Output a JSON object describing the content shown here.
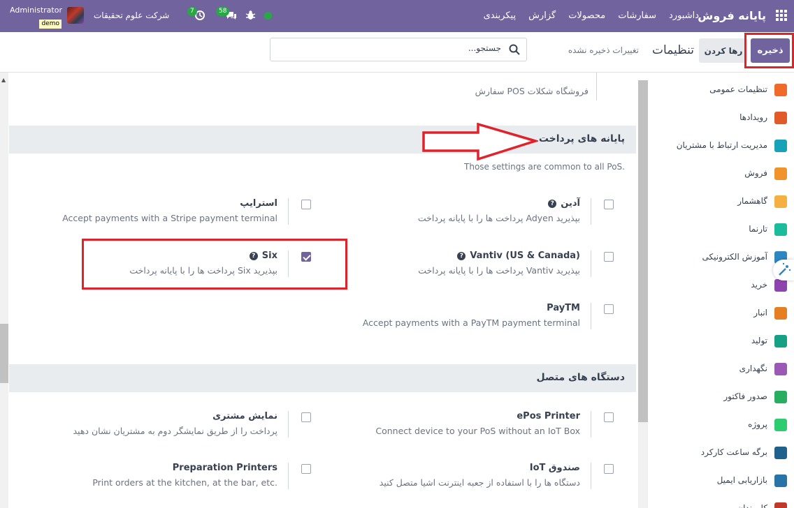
{
  "topnav": {
    "brand": "پایانه فروش",
    "menu": [
      "داشبورد",
      "سفارشات",
      "محصولات",
      "گزارش",
      "پیکربندی"
    ],
    "company": "شرکت علوم تحقیقات",
    "user": "Administrator",
    "db": "demo",
    "messages_count": "58",
    "activities_count": "7",
    "bug_icon": "bug-icon",
    "status_color": "#28a745"
  },
  "control_panel": {
    "save_label": "ذخیره",
    "discard_label": "رها کردن",
    "title": "تنظیمات",
    "unsaved": "تغییرات ذخیره نشده",
    "search_placeholder": "جستجو..."
  },
  "sidebar": {
    "items": [
      {
        "label": "تنظیمات عمومی",
        "color": "#f06a2a"
      },
      {
        "label": "رویدادها",
        "color": "#e05a2a"
      },
      {
        "label": "مدیریت ارتباط با مشتریان",
        "color": "#17a2b8"
      },
      {
        "label": "فروش",
        "color": "#f0932b"
      },
      {
        "label": "گاهشمار",
        "color": "#f5b041"
      },
      {
        "label": "تارنما",
        "color": "#1abc9c"
      },
      {
        "label": "آموزش الکترونیکی",
        "color": "#2e86c1"
      },
      {
        "label": "خرید",
        "color": "#8e44ad"
      },
      {
        "label": "انبار",
        "color": "#e67e22"
      },
      {
        "label": "تولید",
        "color": "#16a085"
      },
      {
        "label": "نگهداری",
        "color": "#9b59b6"
      },
      {
        "label": "صدور فاکتور",
        "color": "#27ae60"
      },
      {
        "label": "پروژه",
        "color": "#2ecc71"
      },
      {
        "label": "برگه ساعت کارکرد",
        "color": "#1f618d"
      },
      {
        "label": "بازاریابی ایمیل",
        "color": "#2874a6"
      },
      {
        "label": "کارمندان",
        "color": "#c0392b"
      }
    ]
  },
  "main": {
    "top_line": "سفارش POS فروشگاه شکلات",
    "payment": {
      "title": "پایانه های پرداخت",
      "subtitle": "Those settings are common to all PoS.",
      "settings": [
        {
          "label": "آدین",
          "desc": "پرداخت ها را با پایانه پرداخت Adyen بپذیرید",
          "checked": false,
          "help": true
        },
        {
          "label": "استرایپ",
          "desc": "Accept payments with a Stripe payment terminal",
          "checked": false,
          "help": false
        },
        {
          "label": "Vantiv (US & Canada)",
          "desc": "پرداخت ها را با پایانه پرداخت Vantiv بپذیرید",
          "checked": false,
          "help": true
        },
        {
          "label": "Six",
          "desc": "پرداخت ها را با پایانه پرداخت Six بپذیرید",
          "checked": true,
          "help": true
        },
        {
          "label": "PayTM",
          "desc": "Accept payments with a PayTM payment terminal",
          "checked": false,
          "help": false
        }
      ]
    },
    "devices": {
      "title": "دستگاه های متصل",
      "settings": [
        {
          "label": "ePos Printer",
          "desc": "Connect device to your PoS without an IoT Box",
          "checked": false
        },
        {
          "label": "نمایش مشتری",
          "desc": "پرداخت را از طریق نمایشگر دوم به مشتریان نشان دهید",
          "checked": false
        },
        {
          "label": "صندوق IoT",
          "desc": "دستگاه ها را با استفاده از جعبه اینترنت اشیا متصل کنید",
          "checked": false
        },
        {
          "label": "Preparation Printers",
          "desc": "Print orders at the kitchen, at the bar, etc.",
          "checked": false
        }
      ]
    }
  },
  "annotations": {
    "highlight_color": "#e0222b"
  }
}
